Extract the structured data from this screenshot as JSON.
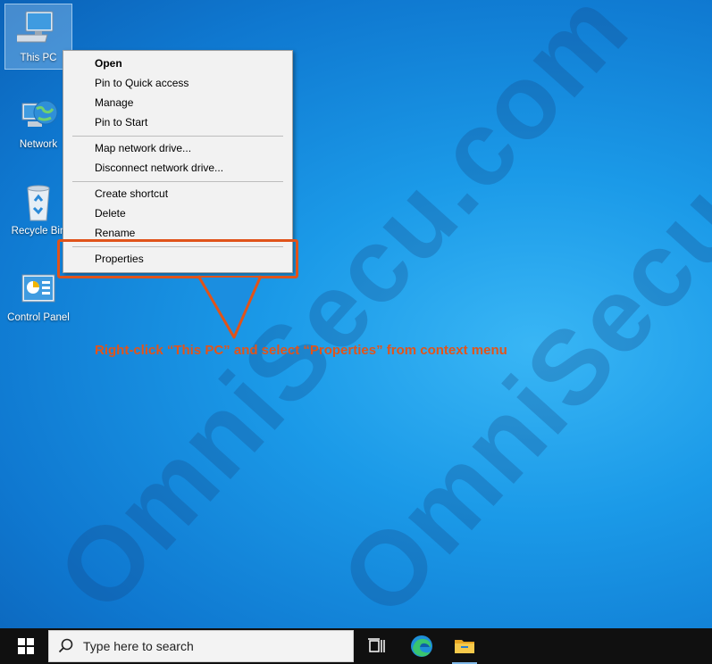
{
  "watermark": "OmniSecu.com",
  "desktop_icons": [
    {
      "label": "This PC",
      "icon": "computer-icon",
      "selected": true
    },
    {
      "label": "Network",
      "icon": "network-globe-icon"
    },
    {
      "label": "Recycle Bin",
      "icon": "recycle-bin-icon"
    },
    {
      "label": "Control Panel",
      "icon": "control-panel-icon"
    }
  ],
  "context_menu": {
    "items": [
      {
        "label": "Open",
        "bold": true
      },
      {
        "label": "Pin to Quick access"
      },
      {
        "label": "Manage"
      },
      {
        "label": "Pin to Start"
      },
      {
        "label": "Map network drive..."
      },
      {
        "label": "Disconnect network drive..."
      },
      {
        "label": "Create shortcut"
      },
      {
        "label": "Delete"
      },
      {
        "label": "Rename"
      },
      {
        "label": "Properties",
        "highlighted": true
      }
    ]
  },
  "annotation": {
    "text": "Right-click “This PC” and select “Properties” from context menu",
    "color": "#e2541a"
  },
  "taskbar": {
    "search_placeholder": "Type here to search",
    "icons": [
      "windows-start-icon",
      "search-icon",
      "task-view-icon",
      "edge-icon",
      "file-explorer-icon"
    ]
  }
}
